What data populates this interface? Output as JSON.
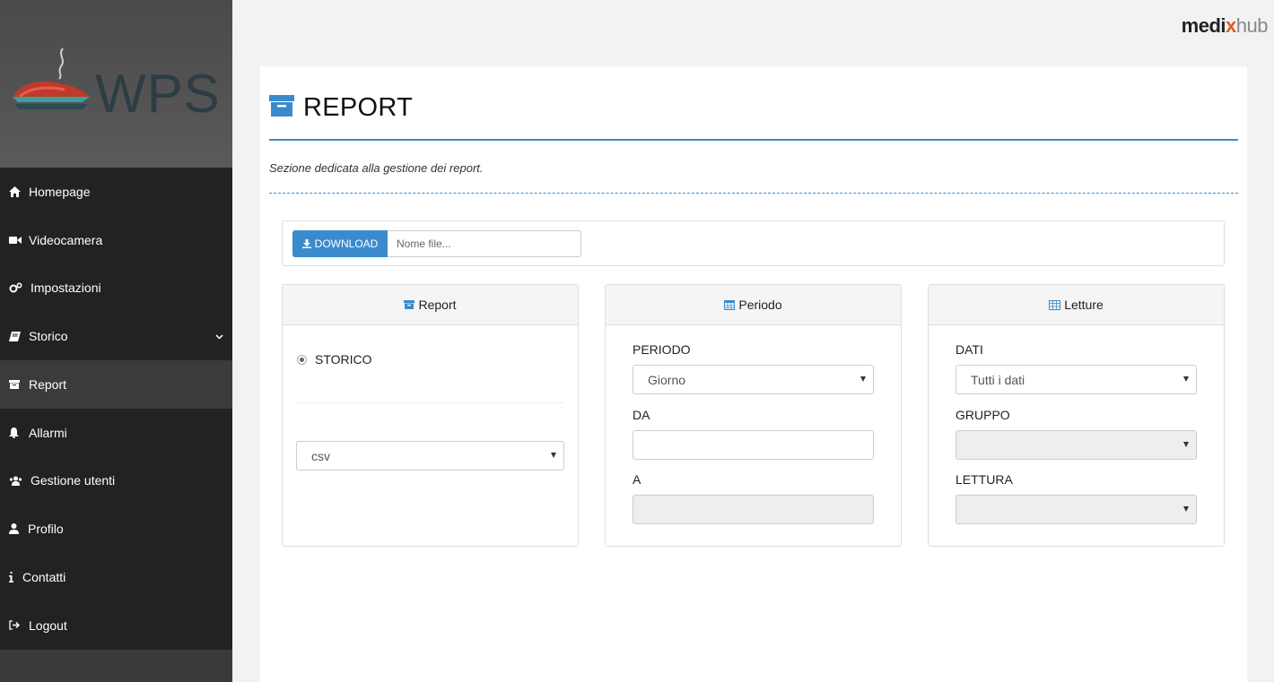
{
  "brand": {
    "part1": "medi",
    "part2": "x",
    "part3": "hub"
  },
  "logo": {
    "text": "WPS"
  },
  "nav": {
    "items": [
      {
        "label": "Homepage",
        "icon": "home-icon"
      },
      {
        "label": "Videocamera",
        "icon": "video-camera-icon"
      },
      {
        "label": "Impostazioni",
        "icon": "cogs-icon"
      },
      {
        "label": "Storico",
        "icon": "book-icon",
        "has_submenu": true
      },
      {
        "label": "Report",
        "icon": "archive-icon",
        "active": true
      },
      {
        "label": "Allarmi",
        "icon": "bell-icon"
      },
      {
        "label": "Gestione utenti",
        "icon": "users-icon"
      },
      {
        "label": "Profilo",
        "icon": "user-icon"
      },
      {
        "label": "Contatti",
        "icon": "info-icon"
      },
      {
        "label": "Logout",
        "icon": "sign-out-icon"
      }
    ]
  },
  "page": {
    "title": "REPORT",
    "subtitle": "Sezione dedicata alla gestione dei report."
  },
  "download": {
    "button_label": "DOWNLOAD",
    "filename_placeholder": "Nome file...",
    "filename_value": ""
  },
  "report_card": {
    "header": "Report",
    "radio_label": "STORICO",
    "format_value": "csv"
  },
  "periodo_card": {
    "header": "Periodo",
    "periodo_label": "PERIODO",
    "periodo_value": "Giorno",
    "da_label": "DA",
    "da_value": "",
    "a_label": "A",
    "a_value": ""
  },
  "letture_card": {
    "header": "Letture",
    "dati_label": "DATI",
    "dati_value": "Tutti i dati",
    "gruppo_label": "GRUPPO",
    "gruppo_value": "",
    "lettura_label": "LETTURA",
    "lettura_value": ""
  },
  "colors": {
    "accent": "#3a8bcd",
    "sidebar_bg": "#222222",
    "sidebar_active": "#3b3b3b",
    "brand_orange": "#e05a21"
  }
}
